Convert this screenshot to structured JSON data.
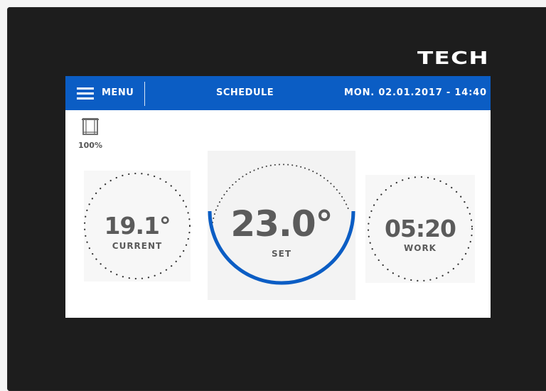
{
  "brand": {
    "logo_text": "TECH"
  },
  "topbar": {
    "menu_label": "MENU",
    "title": "SCHEDULE",
    "datetime": "MON. 02.01.2017 - 14:40"
  },
  "blind": {
    "icon": "window-blind-icon",
    "percent": "100%"
  },
  "current": {
    "value": "19.1°",
    "label": "CURRENT"
  },
  "set": {
    "value": "23.0°",
    "label": "SET"
  },
  "work": {
    "value": "05:20",
    "label": "WORK"
  },
  "colors": {
    "accent": "#0b5dc4",
    "device_frame": "#1d1d1d",
    "text_gray": "#5b5b5b",
    "screen_bg": "#ffffff"
  }
}
